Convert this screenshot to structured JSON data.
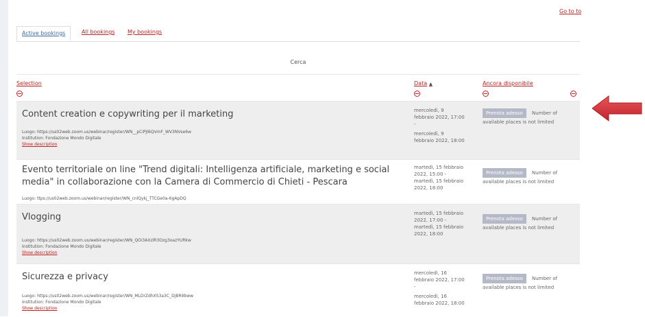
{
  "nav": {
    "go_to_top": "Go to to"
  },
  "tabs": [
    "Active bookings",
    "All bookings",
    "My bookings"
  ],
  "search_label": "Cerca",
  "columns": {
    "selection": "Selection",
    "data": "Data",
    "available": "Ancora disponibile"
  },
  "book_button": "Prenota adesso",
  "availability": [
    "Number of",
    "available places is not limited"
  ],
  "rows": [
    {
      "title": "Content creation e copywriting per il marketing",
      "location": "Luogo: https://us02web.zoom.us/webinar/register/WN__pCiPJl6QVmF_WV3NVse6w",
      "institution": "Institution: Fondazione Mondo Digitale",
      "show": "Show description",
      "date_lines": [
        "mercoledì, 9",
        "febbraio 2022, 17:00",
        "-",
        "mercoledì, 9",
        "febbraio 2022, 18:00"
      ]
    },
    {
      "title": "Evento territoriale on line \"Trend digitali: Intelligenza artificiale, marketing e social media\" in collaborazione con la Camera di Commercio di Chieti - Pescara",
      "location": "Luogo: ttps://us02web.zoom.us/webinar/register/WN_cnlQykj_TTCGe0a-6gApDQ",
      "date_lines": [
        "martedì, 15 febbraio",
        "2022, 15:00 -",
        "martedì, 15 febbraio",
        "2022, 18:00"
      ]
    },
    {
      "title": "Vlogging",
      "location": "Luogo: https://us02web.zoom.us/webinar/register/WN_QOi3AXzlR3Ozg3oazYURkw",
      "institution": "Institution: Fondazione Mondo Digitale",
      "show": "Show description",
      "date_lines": [
        "martedì, 15 febbraio",
        "2022, 17:00 -",
        "martedì, 15 febbraio",
        "2022, 18:00"
      ]
    },
    {
      "title": "Sicurezza e privacy",
      "location": "Luogo: https://us02web.zoom.us/webinar/register/WN_MLDrZdhXS3a3C_DjBR9bww",
      "institution": "Institution: Fondazione Mondo Digitale",
      "show": "Show description",
      "date_lines": [
        "mercoledì, 16",
        "febbraio 2022, 17:00",
        "-",
        "mercoledì, 16",
        "febbraio 2022, 18:00"
      ]
    }
  ],
  "colors": {
    "link": "#b22222",
    "row_shade": "#eeeeee",
    "button": "#b5b9c7",
    "arrow": "#d9363e"
  }
}
